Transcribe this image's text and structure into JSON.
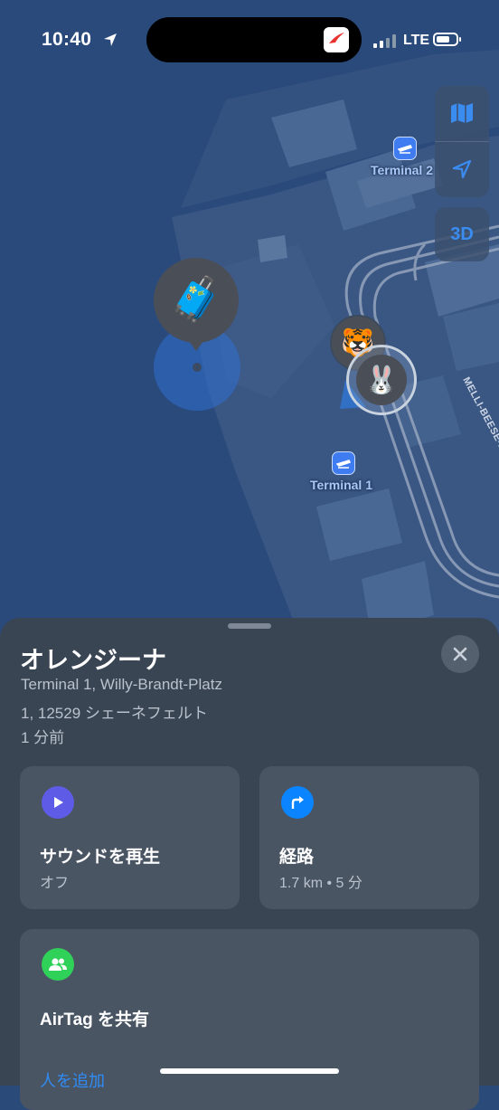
{
  "status_bar": {
    "time": "10:40",
    "carrier": "LTE"
  },
  "map": {
    "terminal_2_label": "Terminal 2",
    "terminal_1_label": "Terminal 1",
    "road_label": "MELLI-BEESE-RING",
    "view_3d_label": "3D",
    "item_emoji": "🧳",
    "person_emojis": [
      "🐯",
      "🐰"
    ]
  },
  "sheet": {
    "title": "オレンジーナ",
    "address_line1": "Terminal 1, Willy-Brandt-Platz",
    "address_line2": "1, 12529 シェーネフェルト",
    "updated": "1 分前",
    "play_sound": {
      "title": "サウンドを再生",
      "subtitle": "オフ"
    },
    "directions": {
      "title": "経路",
      "subtitle": "1.7 km • 5 分"
    },
    "share": {
      "title": "AirTag を共有",
      "add_people": "人を追加"
    }
  },
  "colors": {
    "sound_icon": "#5e5ce6",
    "directions_icon": "#0a84ff",
    "share_icon": "#30d158",
    "accent": "#2f8cf6"
  }
}
